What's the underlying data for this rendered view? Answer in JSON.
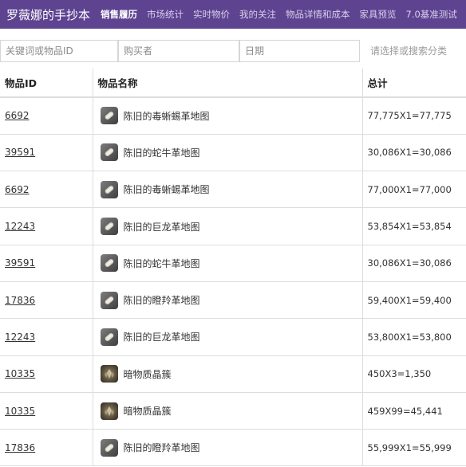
{
  "navbar": {
    "brand": "罗薇娜的手抄本",
    "items": [
      {
        "label": "销售履历",
        "active": true
      },
      {
        "label": "市场统计",
        "active": false
      },
      {
        "label": "实时物价",
        "active": false
      },
      {
        "label": "我的关注",
        "active": false
      },
      {
        "label": "物品详情和成本",
        "active": false
      },
      {
        "label": "家具预览",
        "active": false
      },
      {
        "label": "7.0基准测试",
        "active": false
      }
    ]
  },
  "filters": {
    "keyword_placeholder": "关键词或物品ID",
    "buyer_placeholder": "购买者",
    "date_placeholder": "日期",
    "category_placeholder": "请选择或搜索分类"
  },
  "table": {
    "headers": [
      "物品ID",
      "物品名称",
      "总计"
    ],
    "rows": [
      {
        "id": "6692",
        "name": "陈旧的毒蜥蜴革地图",
        "icon": "map-scroll-icon",
        "total": "77,775X1=77,775"
      },
      {
        "id": "39591",
        "name": "陈旧的蛇牛革地图",
        "icon": "map-scroll-icon",
        "total": "30,086X1=30,086"
      },
      {
        "id": "6692",
        "name": "陈旧的毒蜥蜴革地图",
        "icon": "map-scroll-icon",
        "total": "77,000X1=77,000"
      },
      {
        "id": "12243",
        "name": "陈旧的巨龙革地图",
        "icon": "map-scroll-icon",
        "total": "53,854X1=53,854"
      },
      {
        "id": "39591",
        "name": "陈旧的蛇牛革地图",
        "icon": "map-scroll-icon",
        "total": "30,086X1=30,086"
      },
      {
        "id": "17836",
        "name": "陈旧的瞪羚革地图",
        "icon": "map-scroll-icon",
        "total": "59,400X1=59,400"
      },
      {
        "id": "12243",
        "name": "陈旧的巨龙革地图",
        "icon": "map-scroll-icon",
        "total": "53,800X1=53,800"
      },
      {
        "id": "10335",
        "name": "暗物质晶簇",
        "icon": "crystal-cluster-icon",
        "total": "450X3=1,350"
      },
      {
        "id": "10335",
        "name": "暗物质晶簇",
        "icon": "crystal-cluster-icon",
        "total": "459X99=45,441"
      },
      {
        "id": "17836",
        "name": "陈旧的瞪羚革地图",
        "icon": "map-scroll-icon",
        "total": "55,999X1=55,999"
      }
    ]
  },
  "colors": {
    "navbar_bg": "#5e4391",
    "border": "#dddddd"
  }
}
